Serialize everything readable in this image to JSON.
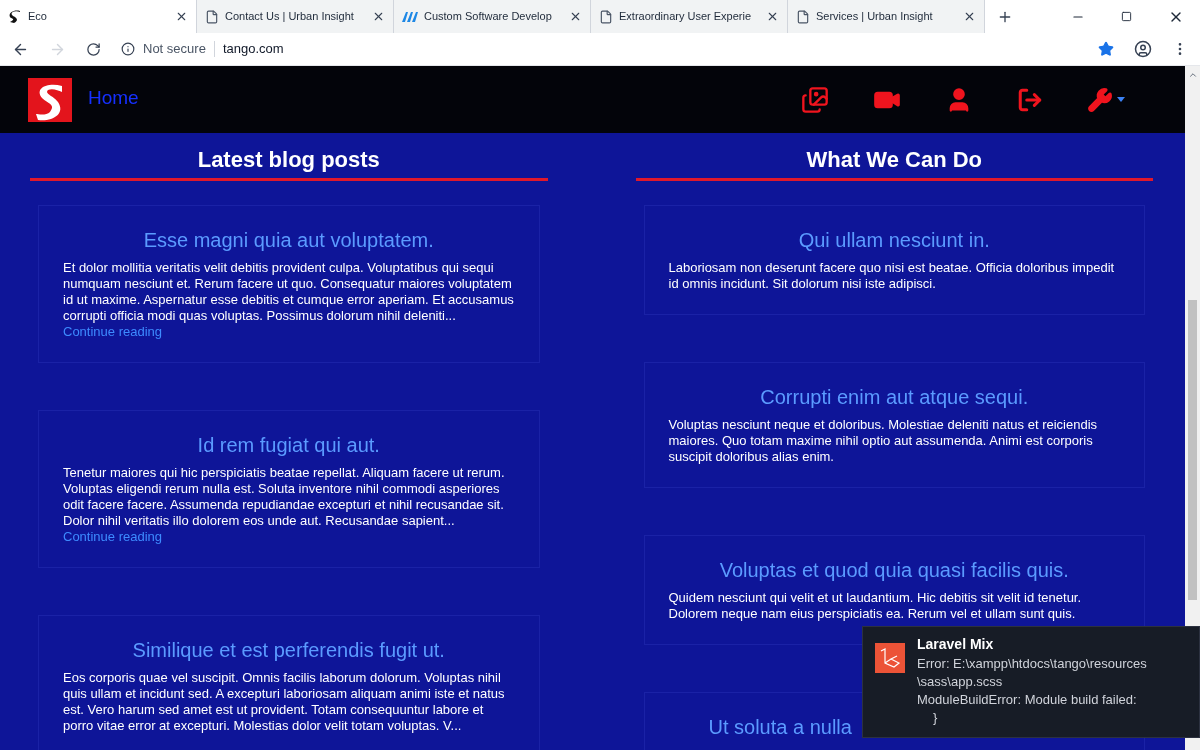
{
  "browser": {
    "tabs": [
      {
        "title": "Eco",
        "kind": "logo",
        "selected": true
      },
      {
        "title": "Contact Us | Urban Insight",
        "kind": "page",
        "selected": false
      },
      {
        "title": "Custom Software Develop",
        "kind": "brand",
        "selected": false
      },
      {
        "title": "Extraordinary User Experie",
        "kind": "page",
        "selected": false
      },
      {
        "title": "Services | Urban Insight",
        "kind": "page",
        "selected": false
      }
    ],
    "security": "Not secure",
    "url": "tango.com",
    "bookmarked": true
  },
  "navbar": {
    "home": "Home"
  },
  "columns": [
    {
      "heading": "Latest blog posts",
      "cards": [
        {
          "title": "Esse magni quia aut voluptatem.",
          "body": "Et dolor mollitia veritatis velit debitis provident culpa. Voluptatibus qui sequi numquam nesciunt et. Rerum facere ut quo. Consequatur maiores voluptatem id ut maxime. Aspernatur esse debitis et cumque error aperiam. Et accusamus corrupti officia modi quas voluptas. Possimus dolorum nihil deleniti...",
          "link": "Continue reading"
        },
        {
          "title": "Id rem fugiat qui aut.",
          "body": "Tenetur maiores qui hic perspiciatis beatae repellat. Aliquam facere ut rerum. Voluptas eligendi rerum nulla est. Soluta inventore nihil commodi asperiores odit facere facere. Assumenda repudiandae excepturi et nihil recusandae sit. Dolor nihil veritatis illo dolorem eos unde aut. Recusandae sapient...",
          "link": "Continue reading"
        },
        {
          "title": "Similique et est perferendis fugit ut.",
          "body": "Eos corporis quae vel suscipit. Omnis facilis laborum dolorum. Voluptas nihil quis ullam et incidunt sed. A excepturi laboriosam aliquam animi iste et natus est. Vero harum sed amet est ut provident. Totam consequuntur labore et porro vitae error at excepturi. Molestias dolor velit totam voluptas. V..."
        }
      ]
    },
    {
      "heading": "What We Can Do",
      "cards": [
        {
          "title": "Qui ullam nesciunt in.",
          "body": "Laboriosam non deserunt facere quo nisi est beatae. Officia doloribus impedit id omnis incidunt. Sit dolorum nisi iste adipisci."
        },
        {
          "title": "Corrupti enim aut atque sequi.",
          "body": "Voluptas nesciunt neque et doloribus. Molestiae deleniti natus et reiciendis maiores. Quo totam maxime nihil optio aut assumenda. Animi est corporis suscipit doloribus alias enim."
        },
        {
          "title": "Voluptas et quod quia quasi facilis quis.",
          "body": "Quidem nesciunt qui velit et ut laudantium. Hic debitis sit velit id tenetur. Dolorem neque nam eius perspiciatis ea. Rerum vel et ullam sunt quis."
        },
        {
          "title": "Ut soluta a nulla",
          "kind": "partial"
        }
      ]
    }
  ],
  "toast": {
    "title": "Laravel Mix",
    "lines": [
      "Error: E:\\xampp\\htdocs\\tango\\resources",
      "\\sass\\app.scss",
      "ModuleBuildError: Module build failed:",
      "}"
    ]
  }
}
